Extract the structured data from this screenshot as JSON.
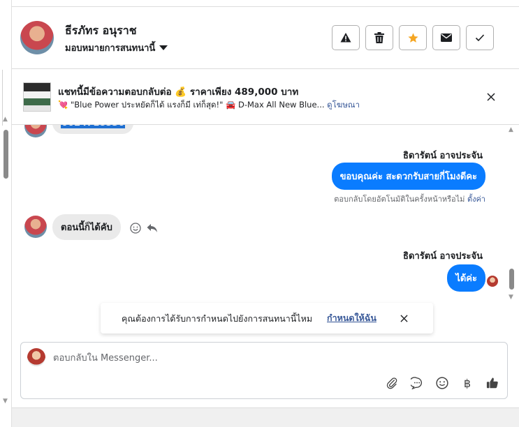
{
  "header": {
    "contact_name": "ธีรภัทร อนุราช",
    "assign_label": "มอบหมายการสนทนานี้",
    "actions": [
      {
        "name": "report",
        "icon": "warning-icon"
      },
      {
        "name": "delete",
        "icon": "trash-icon"
      },
      {
        "name": "star",
        "icon": "star-icon",
        "color": "#f5a623"
      },
      {
        "name": "mail",
        "icon": "mail-icon"
      },
      {
        "name": "done",
        "icon": "check-icon"
      }
    ]
  },
  "ad": {
    "title": "แชทนี้มีข้อความตอบกลับต่อ 💰 ราคาเพียง 489,000 บาท",
    "subtitle": "💘 \"Blue Power ประหยัดก็ได้ แรงก็มี เท่ก็สุด!\" 🚘 D-Max All New Blue...",
    "link": "ดูโฆษณา"
  },
  "messages": {
    "partial_phone": "0624718530",
    "sender_1": "ธิดารัตน์ อาจประจัน",
    "out_1": "ขอบคุณค่ะ สะดวกรับสายกี่โมงดีคะ",
    "auto_note": "ตอบกลับโดยอัตโนมัติในครั้งหน้าหรือไม่",
    "auto_note_link": "ตั้งค่า",
    "in_1": "ตอนนี้ก็ได้คับ",
    "sender_2": "ธิดารัตน์ อาจประจัน",
    "out_2": "ได้ค่ะ"
  },
  "notification": {
    "text": "คุณต้องการได้รับการกำหนดไปยังการสนทนานี้ไหม",
    "link": "กำหนดให้ฉัน"
  },
  "composer": {
    "placeholder": "ตอบกลับใน Messenger...",
    "tools": [
      "paperclip-icon",
      "chat-bubble-icon",
      "emoji-icon",
      "baht-icon",
      "thumbs-up-icon"
    ],
    "currency_symbol": "฿"
  },
  "colors": {
    "accent": "#0a7cff",
    "link": "#385898",
    "star": "#f5a623"
  }
}
